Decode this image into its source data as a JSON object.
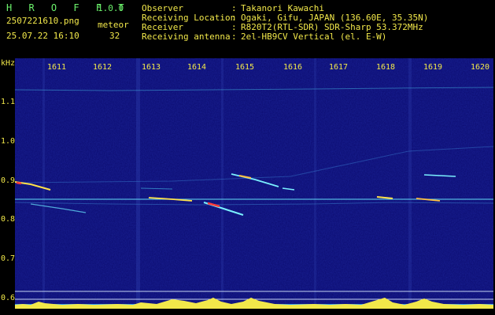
{
  "app": {
    "title": "H R O F F T",
    "version": "1.0.0"
  },
  "file": {
    "name": "2507221610.png",
    "timestamp": "25.07.22 16:10"
  },
  "meteor": {
    "label": "meteor",
    "count": "32"
  },
  "info": [
    {
      "label": "Observer",
      "sep": ":",
      "value": "Takanori Kawachi"
    },
    {
      "label": "Receiving Location",
      "sep": ":",
      "value": "Ogaki, Gifu, JAPAN (136.60E, 35.35N)"
    },
    {
      "label": "Receiver",
      "sep": ":",
      "value": "R820T2(RTL-SDR) SDR-Sharp 53.372MHz"
    },
    {
      "label": "Receiving antenna",
      "sep": ":",
      "value": "2el-HB9CV Vertical (el. E-W)"
    }
  ],
  "axis": {
    "y_unit": "kHz",
    "y_ticks": [
      "1.1",
      "1.0",
      "0.9",
      "0.8",
      "0.7",
      "0.6"
    ],
    "x_ticks": [
      "1611",
      "1612",
      "1613",
      "1614",
      "1615",
      "1616",
      "1617",
      "1618",
      "1619",
      "1620"
    ]
  },
  "colors": {
    "background": "#000000",
    "plot_bg": "#0b0b6e",
    "text_green": "#6cf36c",
    "text_yellow": "#f2e84a",
    "text_cyan": "#6cf0f0"
  }
}
